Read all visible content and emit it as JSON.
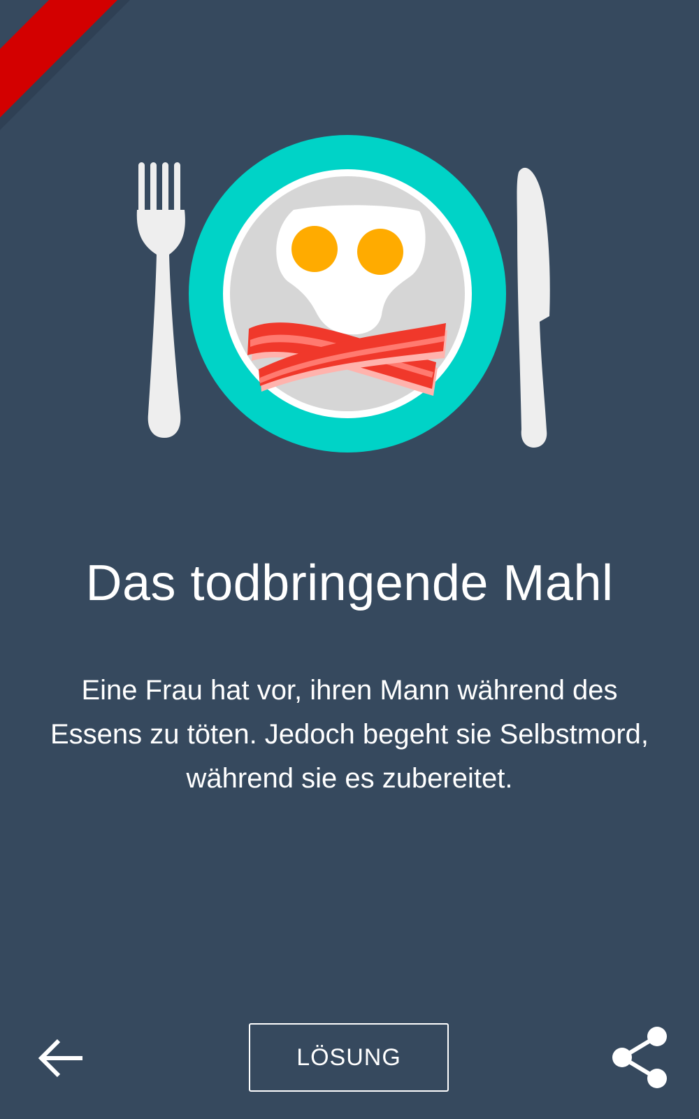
{
  "puzzle": {
    "title": "Das todbringende Mahl",
    "description": "Eine Frau hat vor, ihren Mann während des Essens zu töten. Jedoch begeht sie Selbstmord, während sie es zubereitet."
  },
  "actions": {
    "solution_label": "LÖSUNG"
  },
  "icons": {
    "back": "arrow-left-icon",
    "share": "share-icon",
    "illustration": "plate-eggs-bacon-fork-knife-illustration",
    "corner": "red-corner-ribbon"
  },
  "colors": {
    "background": "#36495e",
    "ribbon": "#d30000",
    "plate_rim": "#00d3c7",
    "plate_inner": "#d6d6d6",
    "yolk": "#ffab00",
    "bacon": "#f0382b",
    "cutlery": "#eeeeee",
    "text": "#ffffff"
  }
}
